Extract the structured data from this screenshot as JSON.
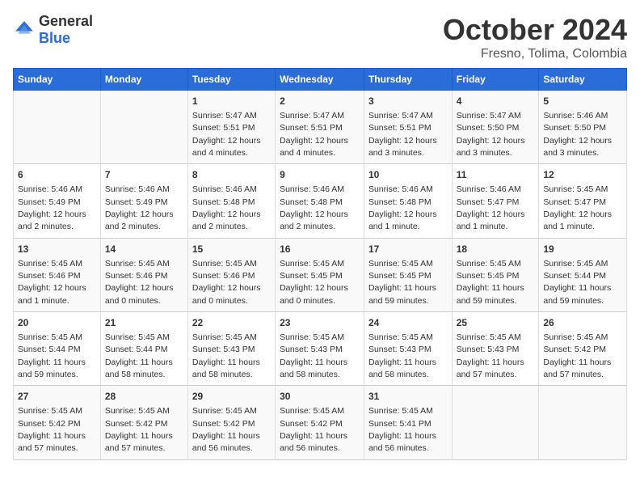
{
  "logo": {
    "general": "General",
    "blue": "Blue"
  },
  "title": "October 2024",
  "location": "Fresno, Tolima, Colombia",
  "days_of_week": [
    "Sunday",
    "Monday",
    "Tuesday",
    "Wednesday",
    "Thursday",
    "Friday",
    "Saturday"
  ],
  "weeks": [
    [
      {
        "day": "",
        "info": ""
      },
      {
        "day": "",
        "info": ""
      },
      {
        "day": "1",
        "info": "Sunrise: 5:47 AM\nSunset: 5:51 PM\nDaylight: 12 hours and 4 minutes."
      },
      {
        "day": "2",
        "info": "Sunrise: 5:47 AM\nSunset: 5:51 PM\nDaylight: 12 hours and 4 minutes."
      },
      {
        "day": "3",
        "info": "Sunrise: 5:47 AM\nSunset: 5:51 PM\nDaylight: 12 hours and 3 minutes."
      },
      {
        "day": "4",
        "info": "Sunrise: 5:47 AM\nSunset: 5:50 PM\nDaylight: 12 hours and 3 minutes."
      },
      {
        "day": "5",
        "info": "Sunrise: 5:46 AM\nSunset: 5:50 PM\nDaylight: 12 hours and 3 minutes."
      }
    ],
    [
      {
        "day": "6",
        "info": "Sunrise: 5:46 AM\nSunset: 5:49 PM\nDaylight: 12 hours and 2 minutes."
      },
      {
        "day": "7",
        "info": "Sunrise: 5:46 AM\nSunset: 5:49 PM\nDaylight: 12 hours and 2 minutes."
      },
      {
        "day": "8",
        "info": "Sunrise: 5:46 AM\nSunset: 5:48 PM\nDaylight: 12 hours and 2 minutes."
      },
      {
        "day": "9",
        "info": "Sunrise: 5:46 AM\nSunset: 5:48 PM\nDaylight: 12 hours and 2 minutes."
      },
      {
        "day": "10",
        "info": "Sunrise: 5:46 AM\nSunset: 5:48 PM\nDaylight: 12 hours and 1 minute."
      },
      {
        "day": "11",
        "info": "Sunrise: 5:46 AM\nSunset: 5:47 PM\nDaylight: 12 hours and 1 minute."
      },
      {
        "day": "12",
        "info": "Sunrise: 5:45 AM\nSunset: 5:47 PM\nDaylight: 12 hours and 1 minute."
      }
    ],
    [
      {
        "day": "13",
        "info": "Sunrise: 5:45 AM\nSunset: 5:46 PM\nDaylight: 12 hours and 1 minute."
      },
      {
        "day": "14",
        "info": "Sunrise: 5:45 AM\nSunset: 5:46 PM\nDaylight: 12 hours and 0 minutes."
      },
      {
        "day": "15",
        "info": "Sunrise: 5:45 AM\nSunset: 5:46 PM\nDaylight: 12 hours and 0 minutes."
      },
      {
        "day": "16",
        "info": "Sunrise: 5:45 AM\nSunset: 5:45 PM\nDaylight: 12 hours and 0 minutes."
      },
      {
        "day": "17",
        "info": "Sunrise: 5:45 AM\nSunset: 5:45 PM\nDaylight: 11 hours and 59 minutes."
      },
      {
        "day": "18",
        "info": "Sunrise: 5:45 AM\nSunset: 5:45 PM\nDaylight: 11 hours and 59 minutes."
      },
      {
        "day": "19",
        "info": "Sunrise: 5:45 AM\nSunset: 5:44 PM\nDaylight: 11 hours and 59 minutes."
      }
    ],
    [
      {
        "day": "20",
        "info": "Sunrise: 5:45 AM\nSunset: 5:44 PM\nDaylight: 11 hours and 59 minutes."
      },
      {
        "day": "21",
        "info": "Sunrise: 5:45 AM\nSunset: 5:44 PM\nDaylight: 11 hours and 58 minutes."
      },
      {
        "day": "22",
        "info": "Sunrise: 5:45 AM\nSunset: 5:43 PM\nDaylight: 11 hours and 58 minutes."
      },
      {
        "day": "23",
        "info": "Sunrise: 5:45 AM\nSunset: 5:43 PM\nDaylight: 11 hours and 58 minutes."
      },
      {
        "day": "24",
        "info": "Sunrise: 5:45 AM\nSunset: 5:43 PM\nDaylight: 11 hours and 58 minutes."
      },
      {
        "day": "25",
        "info": "Sunrise: 5:45 AM\nSunset: 5:43 PM\nDaylight: 11 hours and 57 minutes."
      },
      {
        "day": "26",
        "info": "Sunrise: 5:45 AM\nSunset: 5:42 PM\nDaylight: 11 hours and 57 minutes."
      }
    ],
    [
      {
        "day": "27",
        "info": "Sunrise: 5:45 AM\nSunset: 5:42 PM\nDaylight: 11 hours and 57 minutes."
      },
      {
        "day": "28",
        "info": "Sunrise: 5:45 AM\nSunset: 5:42 PM\nDaylight: 11 hours and 57 minutes."
      },
      {
        "day": "29",
        "info": "Sunrise: 5:45 AM\nSunset: 5:42 PM\nDaylight: 11 hours and 56 minutes."
      },
      {
        "day": "30",
        "info": "Sunrise: 5:45 AM\nSunset: 5:42 PM\nDaylight: 11 hours and 56 minutes."
      },
      {
        "day": "31",
        "info": "Sunrise: 5:45 AM\nSunset: 5:41 PM\nDaylight: 11 hours and 56 minutes."
      },
      {
        "day": "",
        "info": ""
      },
      {
        "day": "",
        "info": ""
      }
    ]
  ]
}
